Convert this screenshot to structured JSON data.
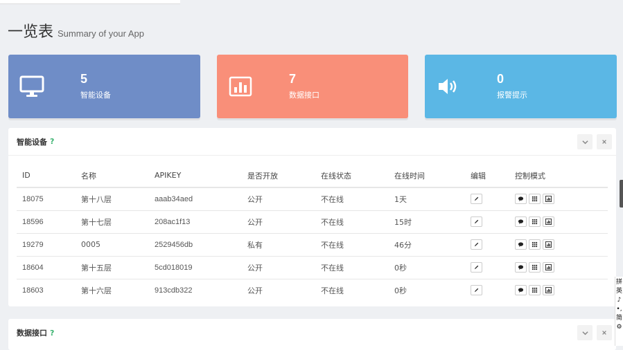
{
  "page": {
    "title": "一览表",
    "subtitle": "Summary of your App"
  },
  "stats": [
    {
      "value": "5",
      "label": "智能设备",
      "icon": "monitor-icon",
      "color": "#6f8dc7"
    },
    {
      "value": "7",
      "label": "数据接口",
      "icon": "bar-chart-icon",
      "color": "#f98f79"
    },
    {
      "value": "0",
      "label": "报警提示",
      "icon": "volume-icon",
      "color": "#5bb7e5"
    }
  ],
  "devices_panel": {
    "title": "智能设备",
    "help": "?",
    "columns": [
      "ID",
      "名称",
      "APIKEY",
      "是否开放",
      "在线状态",
      "在线时间",
      "编辑",
      "控制模式"
    ],
    "rows": [
      {
        "id": "18075",
        "name": "第十八层",
        "apikey": "aaab34aed",
        "open": "公开",
        "status": "不在线",
        "time": "1天"
      },
      {
        "id": "18596",
        "name": "第十七层",
        "apikey": "208ac1f13",
        "open": "公开",
        "status": "不在线",
        "time": "15时"
      },
      {
        "id": "19279",
        "name": "0005",
        "apikey": "2529456db",
        "open": "私有",
        "status": "不在线",
        "time": "46分"
      },
      {
        "id": "18604",
        "name": "第十五层",
        "apikey": "5cd018019",
        "open": "公开",
        "status": "不在线",
        "time": "0秒"
      },
      {
        "id": "18603",
        "name": "第十六层",
        "apikey": "913cdb322",
        "open": "公开",
        "status": "不在线",
        "time": "0秒"
      }
    ]
  },
  "api_panel": {
    "title": "数据接口",
    "help": "?"
  },
  "ime": [
    "拼",
    "英",
    "♪",
    "•,",
    "简",
    "⚙"
  ],
  "colors": {
    "accent_green": "#3cb371",
    "page_bg": "#eef0f3"
  }
}
